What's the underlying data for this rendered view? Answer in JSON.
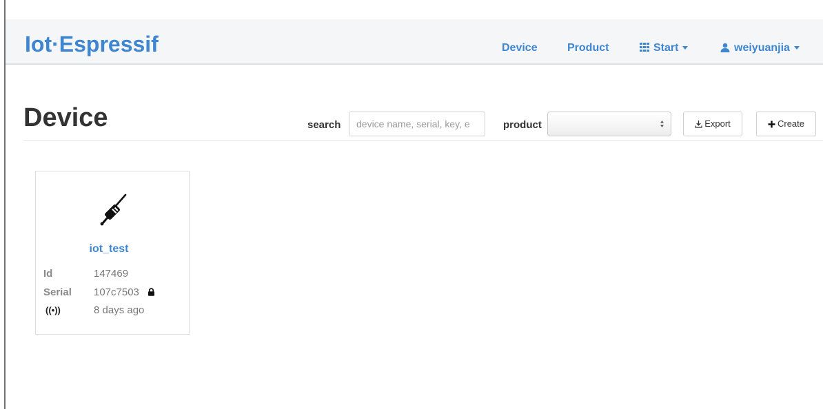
{
  "navbar": {
    "brand": "Iot·Espressif",
    "links": {
      "device": "Device",
      "product": "Product",
      "start": "Start",
      "user": "weiyuanjia"
    }
  },
  "page": {
    "title": "Device",
    "search_label": "search",
    "search_placeholder": "device name, serial, key, e",
    "product_label": "product",
    "product_selected": "",
    "export_label": "Export",
    "create_label": "Create"
  },
  "devices": [
    {
      "name": "iot_test",
      "id_label": "Id",
      "id": "147469",
      "serial_label": "Serial",
      "serial": "107c7503",
      "last_seen": "8 days ago",
      "icon": "plug-icon",
      "serial_icon": "lock-icon",
      "status_icon": "signal-icon"
    }
  ],
  "colors": {
    "accent": "#3f86d1",
    "text": "#333333",
    "muted": "#8a8a8a"
  }
}
